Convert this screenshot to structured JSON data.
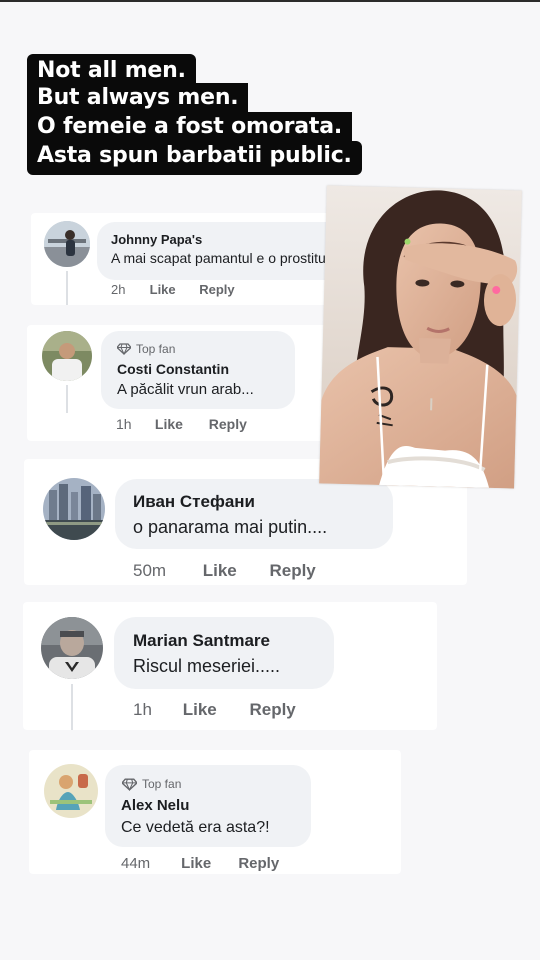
{
  "headline": {
    "lines": [
      "Not all men.",
      "But always men.",
      "O femeie a fost omorata.",
      "Asta spun barbatii public."
    ]
  },
  "comments": [
    {
      "name": "Johnny Papa's",
      "text": "A mai scapat pamantul e o prostituat",
      "time": "2h",
      "like": "Like",
      "reply": "Reply"
    },
    {
      "badge": "Top fan",
      "name": "Costi Constantin",
      "text": "A păcălit vrun arab...",
      "time": "1h",
      "like": "Like",
      "reply": "Reply"
    },
    {
      "name": "Иван Стефани",
      "text": "o panarama mai putin....",
      "time": "50m",
      "like": "Like",
      "reply": "Reply"
    },
    {
      "name": "Marian Santmare",
      "text": "Riscul meseriei.....",
      "time": "1h",
      "like": "Like",
      "reply": "Reply"
    },
    {
      "badge": "Top fan",
      "name": "Alex Nelu",
      "text": "Ce vedetă era asta?!",
      "time": "44m",
      "like": "Like",
      "reply": "Reply"
    }
  ],
  "icons": {
    "top_fan": "diamond-icon"
  },
  "colors": {
    "headline_bg": "#0a0a0a",
    "bubble_bg": "#f0f2f5",
    "meta_text": "#65676b"
  }
}
